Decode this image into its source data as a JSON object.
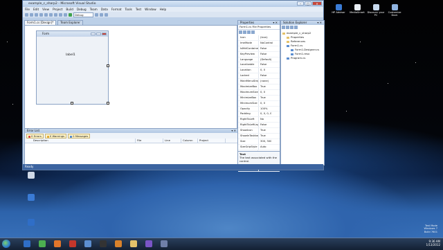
{
  "window": {
    "title": "example_c_sharp2 - Microsoft Visual Studio",
    "menu": [
      "File",
      "Edit",
      "View",
      "Project",
      "Build",
      "Debug",
      "Team",
      "Data",
      "Format",
      "Tools",
      "Test",
      "Window",
      "Help"
    ],
    "config_combo": "Debug"
  },
  "editor": {
    "tabs": [
      {
        "label": "Form1.cs [Design]*"
      },
      {
        "label": "Team Explorer"
      }
    ],
    "form_title": "Form",
    "label_text": "label1"
  },
  "error_list": {
    "header": "Error List",
    "tabs": [
      {
        "label": "0 Errors"
      },
      {
        "label": "0 Warnings"
      },
      {
        "label": "0 Messages"
      }
    ],
    "columns": [
      "Description",
      "File",
      "Line",
      "Column",
      "Project"
    ]
  },
  "properties": {
    "header": "Properties",
    "object": "Form1.cs File Properties",
    "rows": [
      {
        "k": "Icon",
        "v": "(Icon)"
      },
      {
        "k": "ImeMode",
        "v": "NoControl"
      },
      {
        "k": "IsMdiContainer",
        "v": "False"
      },
      {
        "k": "KeyPreview",
        "v": "False"
      },
      {
        "k": "Language",
        "v": "(Default)"
      },
      {
        "k": "Localizable",
        "v": "False"
      },
      {
        "k": "Location",
        "v": "0, 0"
      },
      {
        "k": "Locked",
        "v": "False"
      },
      {
        "k": "MainMenuStrip",
        "v": "(none)"
      },
      {
        "k": "MaximizeBox",
        "v": "True"
      },
      {
        "k": "MaximumSize",
        "v": "0, 0"
      },
      {
        "k": "MinimizeBox",
        "v": "True"
      },
      {
        "k": "MinimumSize",
        "v": "0, 0"
      },
      {
        "k": "Opacity",
        "v": "100%"
      },
      {
        "k": "Padding",
        "v": "0, 0, 0, 0"
      },
      {
        "k": "RightToLeft",
        "v": "No"
      },
      {
        "k": "RightToLeftLayout",
        "v": "False"
      },
      {
        "k": "ShowIcon",
        "v": "True"
      },
      {
        "k": "ShowInTaskbar",
        "v": "True"
      },
      {
        "k": "Size",
        "v": "300, 300"
      },
      {
        "k": "SizeGripStyle",
        "v": "Auto"
      },
      {
        "k": "StartPosition",
        "v": "WindowsDefault"
      },
      {
        "k": "Tag",
        "v": ""
      },
      {
        "k": "Text",
        "v": "Form"
      },
      {
        "k": "TopMost",
        "v": "False"
      }
    ],
    "desc_title": "Text",
    "desc_text": "The text associated with the control."
  },
  "solution": {
    "header": "Solution Explorer",
    "items": [
      {
        "label": "example_c_sharp2"
      },
      {
        "label": "Properties"
      },
      {
        "label": "References"
      },
      {
        "label": "Form1.cs"
      },
      {
        "label": "Form1.Designer.cs"
      },
      {
        "label": "Form1.resx"
      },
      {
        "label": "Program.cs"
      }
    ]
  },
  "status": "Ready",
  "desktop_top_icons": [
    {
      "label": "HP Advisor",
      "color": "#3a7bd5"
    },
    {
      "label": "MediaSmart",
      "color": "#e9eef5"
    },
    {
      "label": "Discover your PC",
      "color": "#c7d9ee"
    },
    {
      "label": "Customize Dock",
      "color": "#8fb3df"
    }
  ],
  "desktop_left_icons": [
    {
      "label": "",
      "color": "#cfd8e6"
    },
    {
      "label": "",
      "color": "#3a7bd5"
    },
    {
      "label": "",
      "color": "#2f6ec7"
    }
  ],
  "taskbar_icons": [
    {
      "name": "windows-media-icon",
      "color": "#2f6ec7"
    },
    {
      "name": "check-icon",
      "color": "#4caf50"
    },
    {
      "name": "firefox-icon",
      "color": "#e2762b"
    },
    {
      "name": "antivirus-icon",
      "color": "#c3362b"
    },
    {
      "name": "tool-icon",
      "color": "#5c8ed0"
    },
    {
      "name": "media-icon",
      "color": "#333333"
    },
    {
      "name": "browser-icon",
      "color": "#d9822b"
    },
    {
      "name": "folder-icon",
      "color": "#e4c26a"
    },
    {
      "name": "vs-icon",
      "color": "#7a55c7"
    },
    {
      "name": "app-icon",
      "color": "#6f7fa8"
    }
  ],
  "tray": {
    "time": "9:36 AM",
    "date": "1/13/2012"
  },
  "watermark": [
    "Test Mode",
    "Windows 7",
    "Build 7601"
  ]
}
